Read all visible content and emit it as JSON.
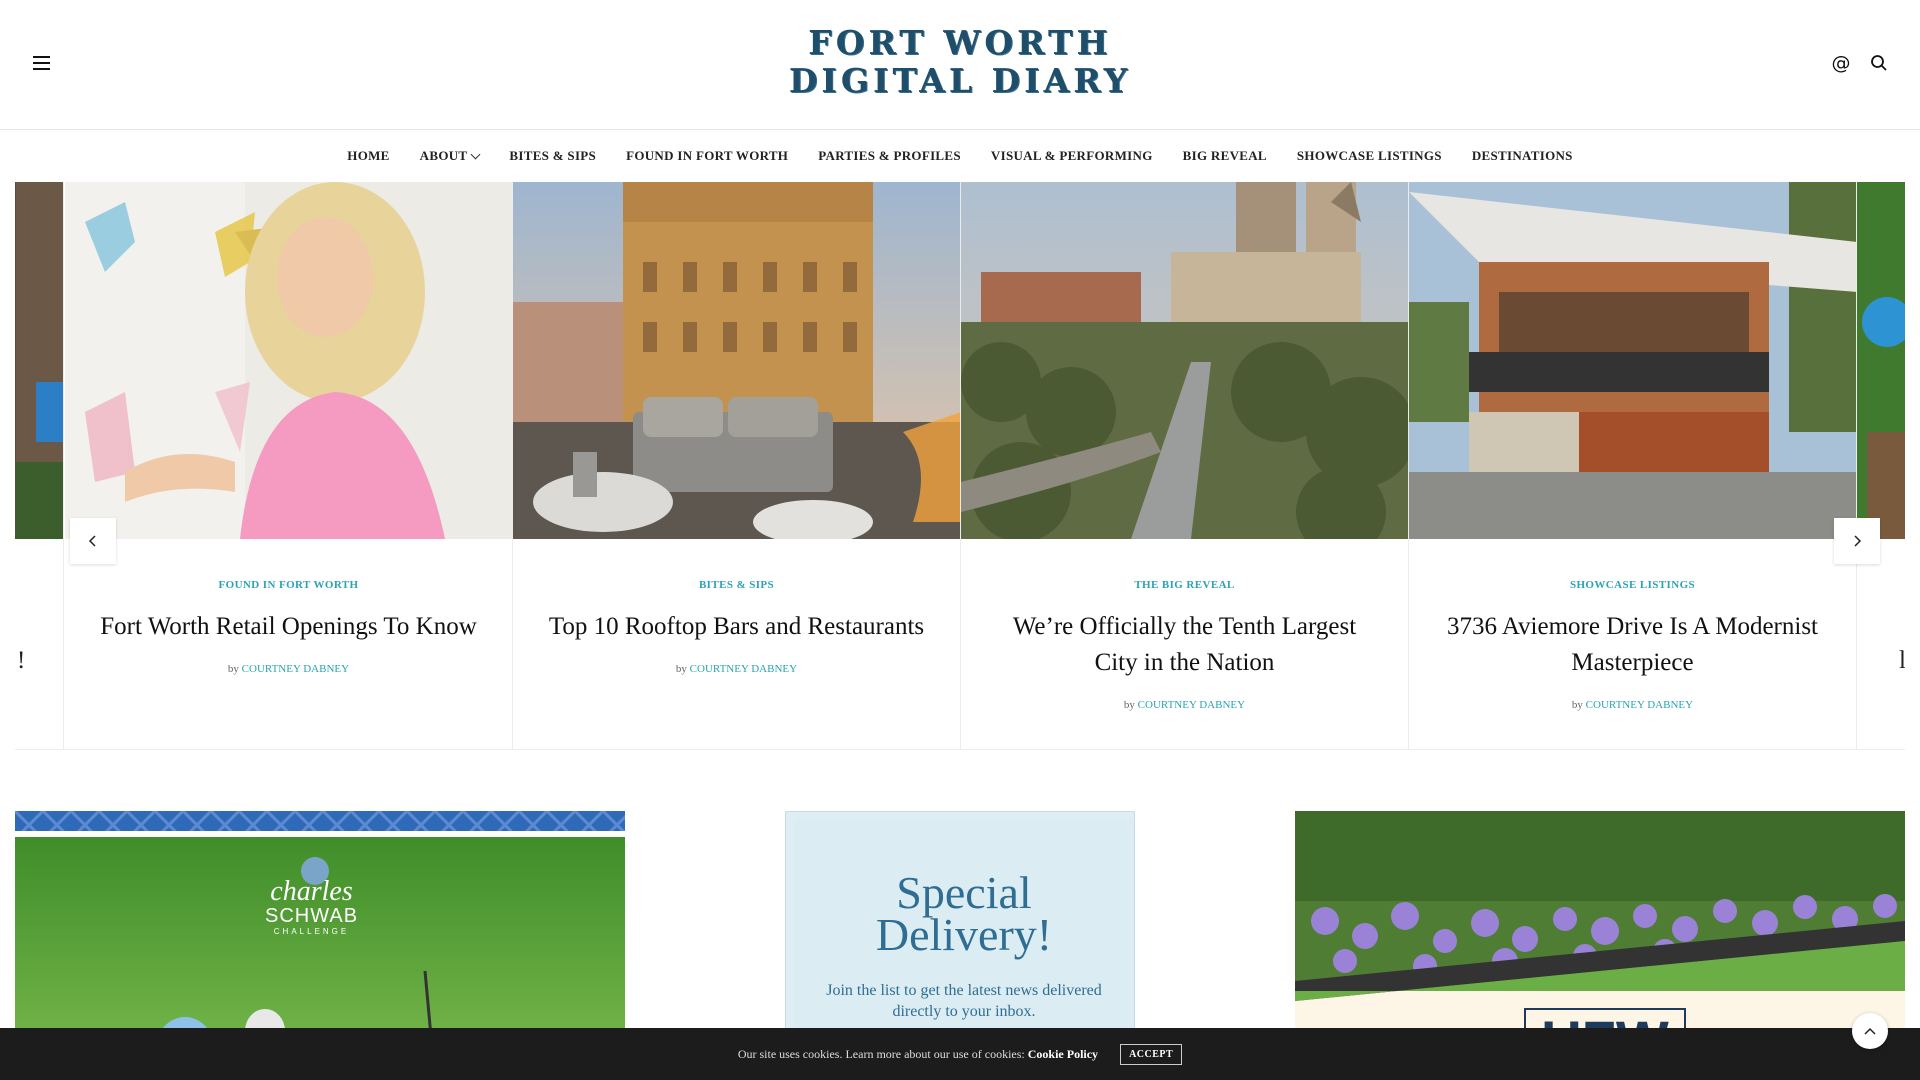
{
  "header": {
    "logo_line1": "FORT WORTH",
    "logo_line2": "DIGITAL DIARY",
    "icons": [
      "menu-icon",
      "at-icon",
      "search-icon"
    ],
    "at_glyph": "@"
  },
  "nav": {
    "items": [
      {
        "label": "HOME"
      },
      {
        "label": "ABOUT",
        "has_dropdown": true
      },
      {
        "label": "BITES & SIPS"
      },
      {
        "label": "FOUND IN FORT WORTH"
      },
      {
        "label": "PARTIES & PROFILES"
      },
      {
        "label": "VISUAL & PERFORMING"
      },
      {
        "label": "BIG REVEAL"
      },
      {
        "label": "SHOWCASE LISTINGS"
      },
      {
        "label": "DESTINATIONS"
      }
    ]
  },
  "carousel": {
    "partial_left_glyph": "!",
    "partial_right_glyph": "l",
    "by_label": "by",
    "slides": [
      {
        "category": "FOUND IN FORT WORTH",
        "title": "Fort Worth Retail Openings To Know",
        "author": "COURTNEY DABNEY"
      },
      {
        "category": "BITES & SIPS",
        "title": "Top 10 Rooftop Bars and Restaurants",
        "author": "COURTNEY DABNEY"
      },
      {
        "category": "THE BIG REVEAL",
        "title": "We’re Officially the Tenth Largest City in the Nation",
        "author": "COURTNEY DABNEY"
      },
      {
        "category": "SHOWCASE LISTINGS",
        "title": "3736 Aviemore Drive Is A Modernist Masterpiece",
        "author": "COURTNEY DABNEY"
      }
    ]
  },
  "ad_left": {
    "brand_line1": "charles",
    "brand_line2": "SCHWAB",
    "brand_line3": "CHALLENGE"
  },
  "promo": {
    "title_line1": "Special",
    "title_line2": "Delivery!",
    "text": "Join the list to get the latest news delivered directly to your inbox."
  },
  "ad_right": {
    "sign_text": "UFW"
  },
  "cookie": {
    "text": "Our site uses cookies. Learn more about our use of cookies:",
    "link": "Cookie Policy",
    "accept": "ACCEPT"
  },
  "colors": {
    "accent": "#2ba3b5",
    "logo": "#1f4e6b",
    "promo_text": "#2f6e92",
    "cookie_bg": "#1c1c1c"
  }
}
